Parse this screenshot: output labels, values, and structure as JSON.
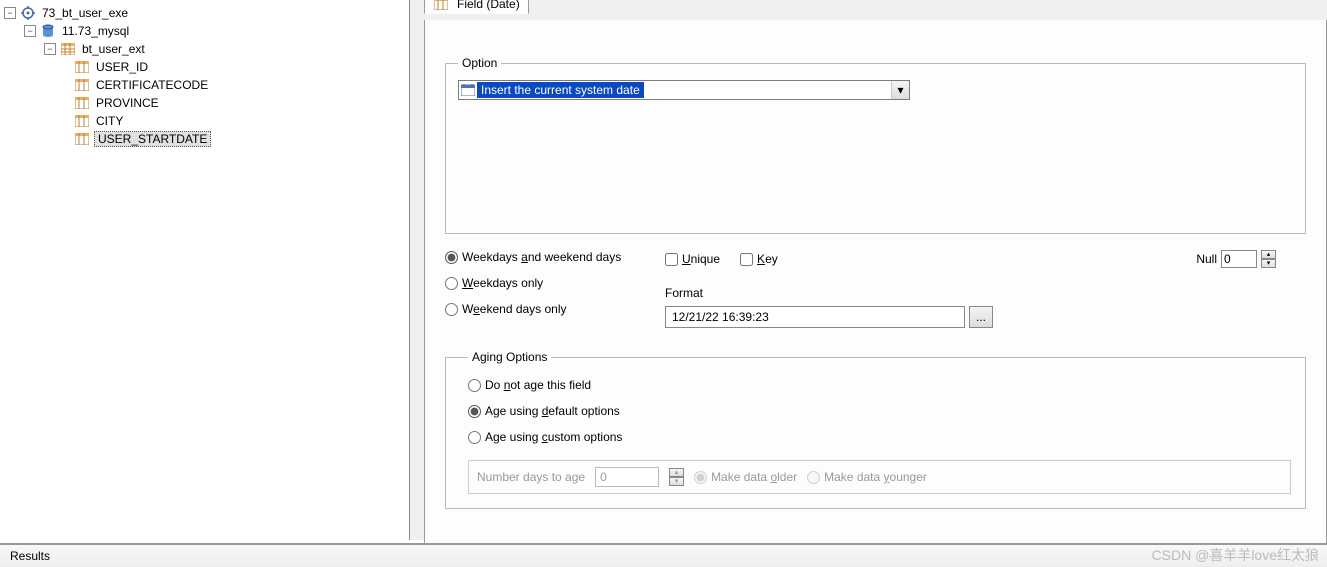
{
  "tree": {
    "root": "73_bt_user_exe",
    "db": "11.73_mysql",
    "table": "bt_user_ext",
    "columns": [
      "USER_ID",
      "CERTIFICATECODE",
      "PROVINCE",
      "CITY",
      "USER_STARTDATE"
    ],
    "selected": "USER_STARTDATE"
  },
  "tab": {
    "label": "Field (Date)"
  },
  "option": {
    "label": "Option",
    "selected_text": "Insert the current system date"
  },
  "day_mode": {
    "both_pre": "Weekdays ",
    "both_u": "a",
    "both_post": "nd weekend days",
    "weekdays_u": "W",
    "weekdays_post": "eekdays only",
    "weekend_pre": "W",
    "weekend_u": "e",
    "weekend_post": "ekend days only"
  },
  "checks": {
    "unique_u": "U",
    "unique_post": "nique",
    "key_u": "K",
    "key_post": "ey"
  },
  "null": {
    "label": "Null",
    "value": "0"
  },
  "format": {
    "label": "Format",
    "value": "12/21/22 16:39:23",
    "btn": "..."
  },
  "aging": {
    "legend": "Aging Options",
    "r1_pre": "Do ",
    "r1_u": "n",
    "r1_post": "ot age this field",
    "r2_pre": "Age using ",
    "r2_u": "d",
    "r2_post": "efault options",
    "r3_pre": "Age using ",
    "r3_u": "c",
    "r3_post": "ustom options",
    "num_label": "Number days to age",
    "num_value": "0",
    "older_pre": "Make data ",
    "older_u": "o",
    "older_post": "lder",
    "younger_pre": "Make data ",
    "younger_u": "y",
    "younger_post": "ounger"
  },
  "results": {
    "label": "Results"
  },
  "watermark": "CSDN @喜羊羊love红太狼"
}
